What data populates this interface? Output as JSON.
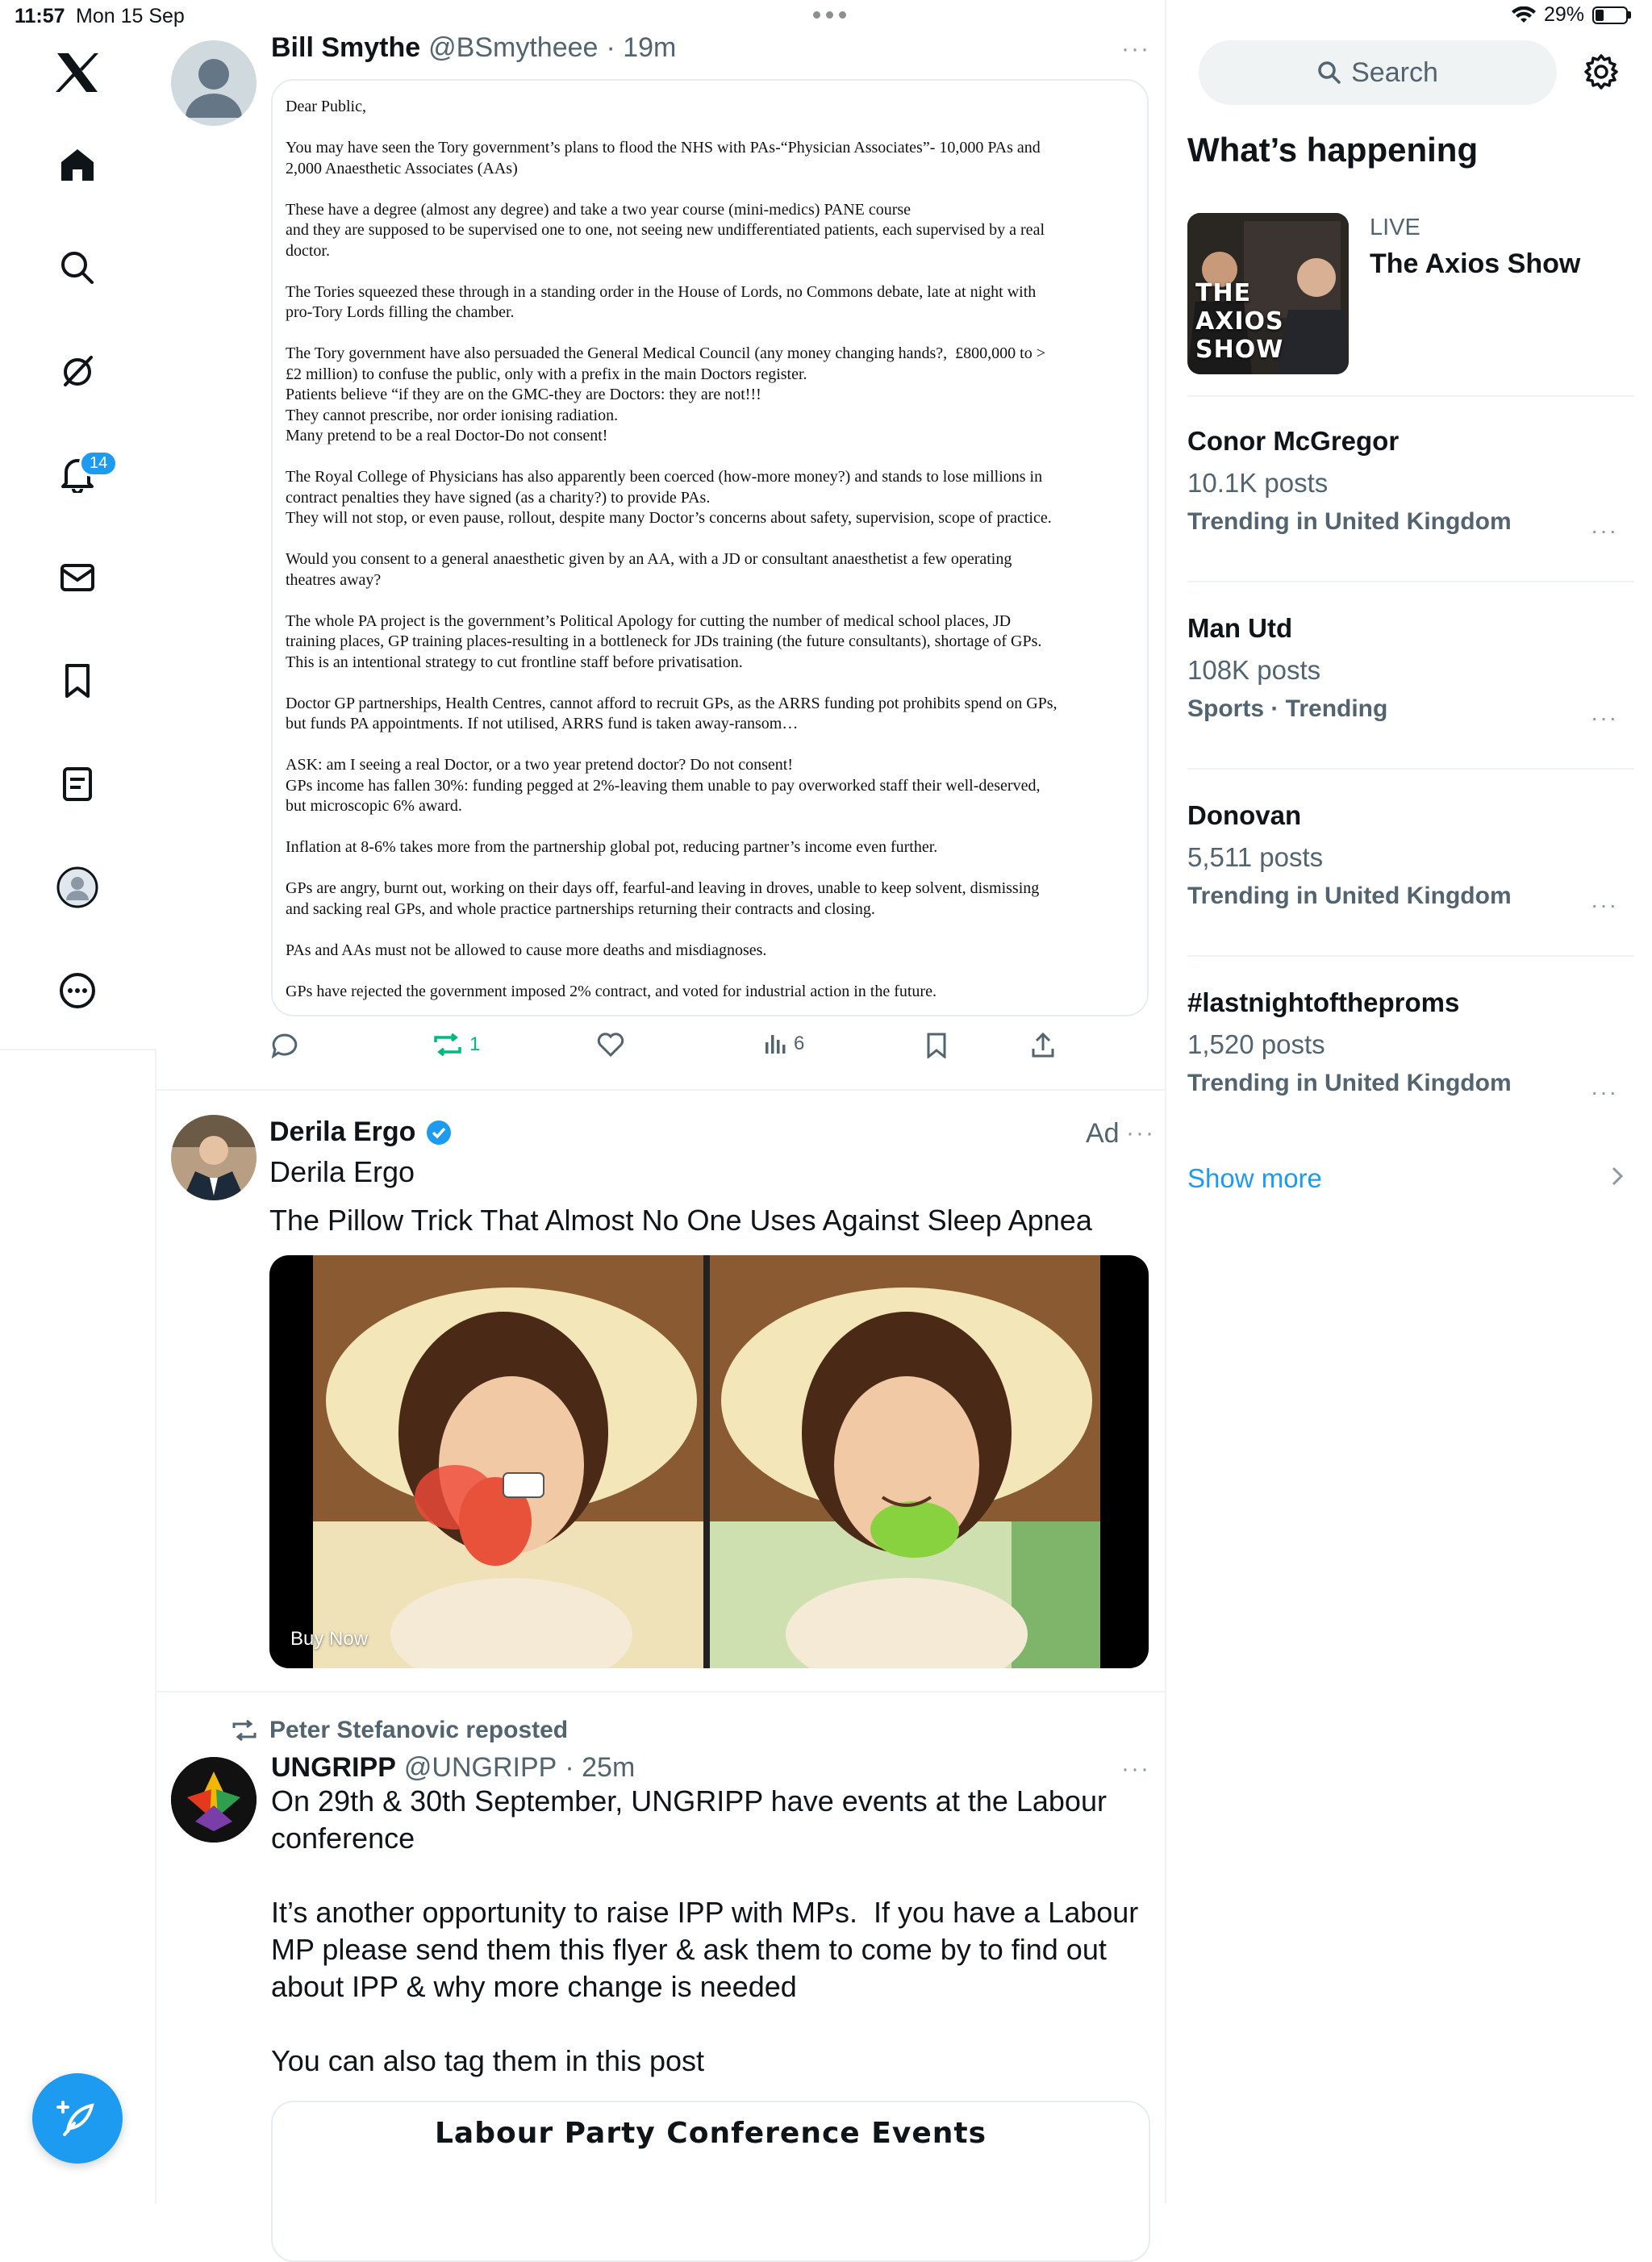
{
  "status_bar": {
    "time": "11:57",
    "date": "Mon 15 Sep",
    "battery": "29%",
    "battery_level": 0.29
  },
  "nav": {
    "notification_badge": "14"
  },
  "tweets": [
    {
      "name": "Bill Smythe",
      "handle": "@BSmytheee",
      "time": "· 19m",
      "document_text": "Dear Public,\n\nYou may have seen the Tory government’s plans to flood the NHS with PAs-“Physician Associates”- 10,000 PAs and\n2,000 Anaesthetic Associates (AAs)\n\nThese have a degree (almost any degree) and take a two year course (mini-medics) PANE course\nand they are supposed to be supervised one to one, not seeing new undifferentiated patients, each supervised by a real\ndoctor.\n\nThe Tories squeezed these through in a standing order in the House of Lords, no Commons debate, late at night with\npro-Tory Lords filling the chamber.\n\nThe Tory government have also persuaded the General Medical Council (any money changing hands?,  £800,000 to >\n£2 million) to confuse the public, only with a prefix in the main Doctors register.\nPatients believe “if they are on the GMC-they are Doctors: they are not!!!\nThey cannot prescribe, nor order ionising radiation.\nMany pretend to be a real Doctor-Do not consent!\n\nThe Royal College of Physicians has also apparently been coerced (how-more money?) and stands to lose millions in\ncontract penalties they have signed (as a charity?) to provide PAs.\nThey will not stop, or even pause, rollout, despite many Doctor’s concerns about safety, supervision, scope of practice.\n\nWould you consent to a general anaesthetic given by an AA, with a JD or consultant anaesthetist a few operating\ntheatres away?\n\nThe whole PA project is the government’s Political Apology for cutting the number of medical school places, JD\ntraining places, GP training places-resulting in a bottleneck for JDs training (the future consultants), shortage of GPs.\nThis is an intentional strategy to cut frontline staff before privatisation.\n\nDoctor GP partnerships, Health Centres, cannot afford to recruit GPs, as the ARRS funding pot prohibits spend on GPs,\nbut funds PA appointments. If not utilised, ARRS fund is taken away-ransom…\n\nASK: am I seeing a real Doctor, or a two year pretend doctor? Do not consent!\nGPs income has fallen 30%: funding pegged at 2%-leaving them unable to pay overworked staff their well-deserved,\nbut microscopic 6% award.\n\nInflation at 8-6% takes more from the partnership global pot, reducing partner’s income even further.\n\nGPs are angry, burnt out, working on their days off, fearful-and leaving in droves, unable to keep solvent, dismissing\nand sacking real GPs, and whole practice partnerships returning their contracts and closing.\n\nPAs and AAs must not be allowed to cause more deaths and misdiagnoses.\n\nGPs have rejected the government imposed 2% contract, and voted for industrial action in the future.",
      "reposts": "1",
      "views": "6"
    },
    {
      "name": "Derila Ergo",
      "ad_label": "Ad",
      "subtitle": "Derila Ergo",
      "text": "The Pillow Trick That Almost No One Uses Against Sleep Apnea",
      "cta": "Buy Now"
    },
    {
      "reposted_by": "Peter Stefanovic reposted",
      "name": "UNGRIPP",
      "handle": "@UNGRIPP",
      "time": "· 25m",
      "text": "On 29th & 30th September, UNGRIPP have events at the Labour conference\n\nIt’s another opportunity to raise IPP with MPs.  If you have a Labour MP please send them this flyer & ask them to come by to find out about IPP & why more change is needed\n\nYou can also tag them in this post",
      "flyer_title": "Labour Party Conference Events"
    }
  ],
  "sidebar": {
    "search_label": "Search",
    "heading": "What’s happening",
    "live": {
      "label": "LIVE",
      "title": "The Axios Show",
      "thumb_text": "THE AXIOS SHOW"
    },
    "trends": [
      {
        "title": "Conor McGregor",
        "count": "10.1K posts",
        "category": "Trending in United Kingdom"
      },
      {
        "title": "Man Utd",
        "count": "108K posts",
        "category": "Sports · Trending"
      },
      {
        "title": "Donovan",
        "count": "5,511 posts",
        "category": "Trending in United Kingdom"
      },
      {
        "title": "#lastnightoftheproms",
        "count": "1,520 posts",
        "category": "Trending in United Kingdom"
      }
    ],
    "show_more": "Show more"
  },
  "colors": {
    "accent": "#1d9bf0",
    "repost_green": "#00ba7c",
    "text_secondary": "#536471"
  }
}
